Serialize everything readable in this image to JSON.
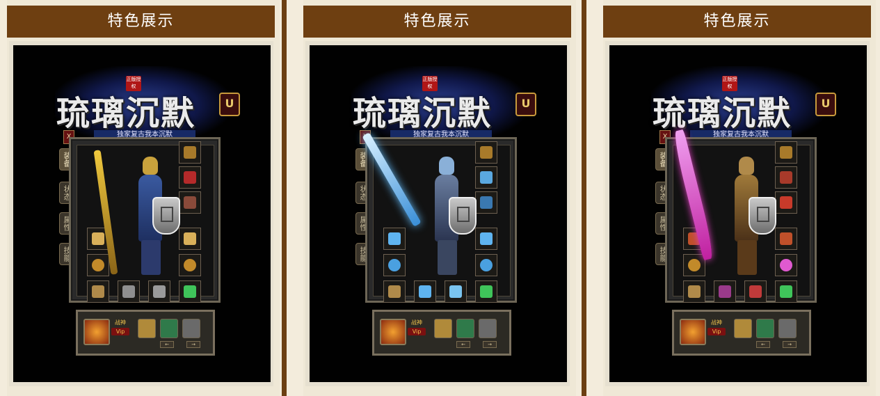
{
  "panels": [
    {
      "header": "特色展示",
      "logo": {
        "title": "琉璃沉默",
        "seal": "正版授权",
        "badge": "U",
        "subtitle": "独家复古我本沉默"
      },
      "tabs": [
        "装备",
        "状态",
        "属性",
        "技能"
      ],
      "close_label": "X",
      "bottom_bar": {
        "vip_label_top": "战神",
        "vip_label_bottom": "Vip",
        "left_arrow": "←",
        "right_arrow": "→"
      }
    },
    {
      "header": "特色展示",
      "logo": {
        "title": "琉璃沉默",
        "seal": "正版授权",
        "badge": "U",
        "subtitle": "独家复古我本沉默"
      },
      "tabs": [
        "装备",
        "状态",
        "属性",
        "技能"
      ],
      "close_label": "X",
      "bottom_bar": {
        "vip_label_top": "战神",
        "vip_label_bottom": "Vip",
        "left_arrow": "←",
        "right_arrow": "→"
      }
    },
    {
      "header": "特色展示",
      "logo": {
        "title": "琉璃沉默",
        "seal": "正版授权",
        "badge": "U",
        "subtitle": "独家复古我本沉默"
      },
      "tabs": [
        "装备",
        "状态",
        "属性",
        "技能"
      ],
      "close_label": "X",
      "bottom_bar": {
        "vip_label_top": "战神",
        "vip_label_bottom": "Vip",
        "left_arrow": "←",
        "right_arrow": "→"
      }
    }
  ],
  "colors": {
    "header_bg": "#6e3f11",
    "divider": "#6b3f12",
    "page_bg": "#f3ecdc",
    "theme_gold": "#c9a23c",
    "theme_ice": "#5fb4f0",
    "theme_pink": "#e040c0"
  }
}
